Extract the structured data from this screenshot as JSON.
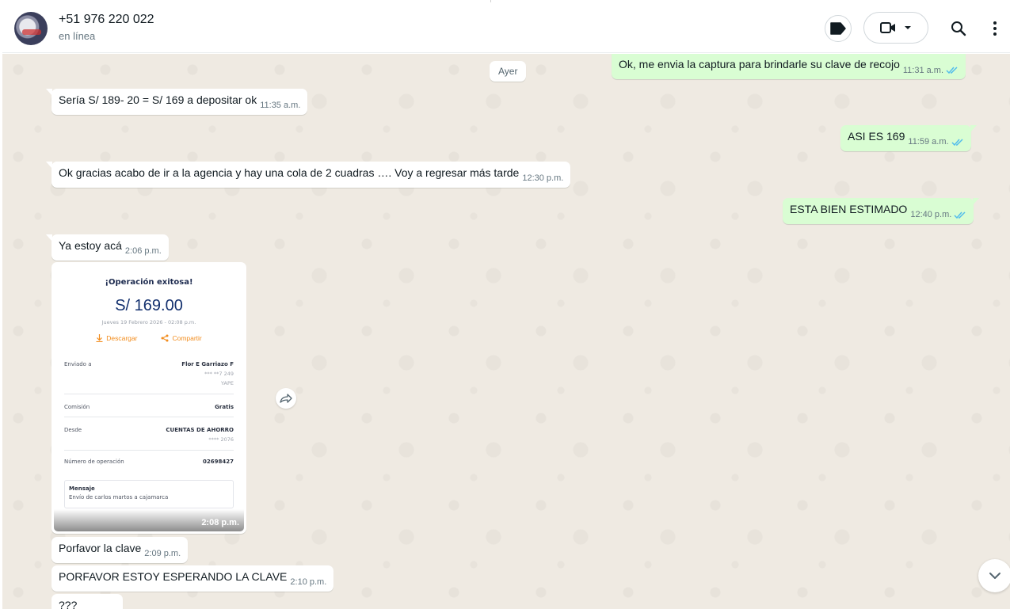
{
  "header": {
    "contact_name": "+51 976 220 022",
    "status": "en línea",
    "icons": [
      "avatar",
      "label-icon",
      "video-call-icon",
      "chevron-down-icon",
      "search-icon",
      "menu-icon"
    ]
  },
  "chat": {
    "day_chip": "Ayer",
    "messages": [
      {
        "dir": "out",
        "text": "Ok, me envia la captura para brindarle su clave de recojo",
        "time": "11:31 a.m.",
        "read": true
      },
      {
        "dir": "in",
        "text": "Sería S/ 189- 20 = S/ 169 a depositar ok",
        "time": "11:35 a.m."
      },
      {
        "dir": "out",
        "text": "ASI ES 169",
        "time": "11:59 a.m.",
        "read": true
      },
      {
        "dir": "in",
        "text": "Ok gracias acabo de ir a la agencia y hay una cola de 2 cuadras …. Voy a regresar más tarde",
        "time": "12:30 p.m."
      },
      {
        "dir": "out",
        "text": "ESTA BIEN ESTIMADO",
        "time": "12:40 p.m.",
        "read": true
      },
      {
        "dir": "in",
        "text": "Ya estoy acá",
        "time": "2:06 p.m."
      },
      {
        "dir": "in",
        "text": "Porfavor la clave",
        "time": "2:09 p.m."
      },
      {
        "dir": "in",
        "text": "PORFAVOR ESTOY ESPERANDO LA CLAVE",
        "time": "2:10 p.m."
      },
      {
        "dir": "in",
        "text": "???",
        "time": ""
      }
    ],
    "image_message": {
      "time": "2:08 p.m.",
      "receipt": {
        "title": "¡Operación exitosa!",
        "amount": "S/ 169.00",
        "date": "Jueves 19 Febrero 2026 - 02:08 p.m.",
        "download": "Descargar",
        "share": "Compartir",
        "sent_to_label": "Enviado a",
        "sent_to_name": "Flor E Garriazo F",
        "sent_to_phone": "*** **7 249",
        "sent_to_app": "YAPE",
        "commission_label": "Comisión",
        "commission_value": "Gratis",
        "from_label": "Desde",
        "from_value": "CUENTAS DE AHORRO",
        "from_account": "**** 2076",
        "op_label": "Número de operación",
        "op_value": "02698427",
        "message_label": "Mensaje",
        "message_value": "Envío de carlos martos a cajamarca"
      }
    }
  },
  "colors": {
    "chat_bg": "#efeae2",
    "outgoing_bubble": "#d9fdd3",
    "incoming_bubble": "#ffffff",
    "read_tick": "#53bdeb",
    "receipt_amount": "#13306e",
    "receipt_action": "#f28c1c"
  }
}
